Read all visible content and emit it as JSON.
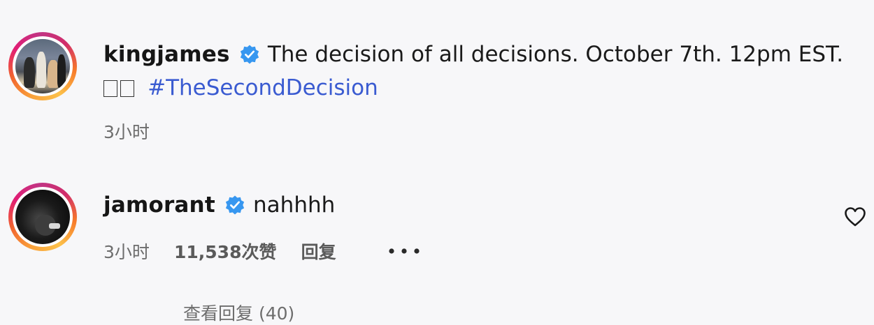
{
  "post": {
    "username": "kingjames",
    "caption": "The decision of all decisions. October 7th. 12pm EST.",
    "emoji_placeholder": "",
    "hashtag": "#TheSecondDecision",
    "time": "3小时"
  },
  "reply": {
    "username": "jamorant",
    "text": "nahhhh",
    "time": "3小时",
    "likes": "11,538次赞",
    "reply_label": "回复"
  },
  "view_replies": "查看回复 (40)",
  "colors": {
    "verified_blue": "#3797f0",
    "hashtag_blue": "#3a5bd1",
    "meta_gray": "#6d6d6d"
  },
  "icons": {
    "verified": "verified-badge-icon",
    "heart": "heart-outline-icon",
    "more": "more-dots-icon"
  }
}
